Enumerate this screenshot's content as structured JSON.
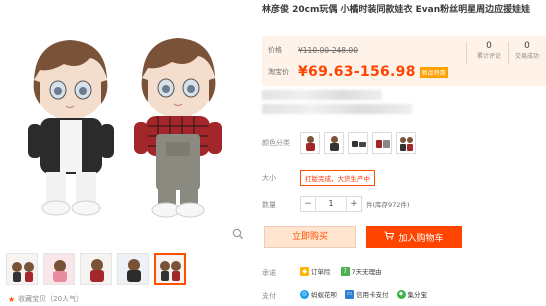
{
  "product": {
    "title": "林彦俊 20cm玩偶 小橘时装同款娃衣 Evan粉丝明星周边应援娃娃"
  },
  "price": {
    "list_label": "价格",
    "list_value": "¥110.00-248.00",
    "promo_label": "淘宝价",
    "promo_value": "¥69.63-156.98",
    "promo_badge": "新品特惠"
  },
  "stats": [
    {
      "count": "0",
      "label": "累计评论"
    },
    {
      "count": "0",
      "label": "交易成功"
    }
  ],
  "options": {
    "color_label": "颜色分类",
    "size_label": "大小",
    "size_value": "打版完成，大货生产中",
    "qty_label": "数量",
    "qty_minus": "−",
    "qty_value": "1",
    "qty_plus": "+",
    "stock_text": "件(库存972件)"
  },
  "actions": {
    "buy_now": "立即购买",
    "add_cart": "加入购物车",
    "cart_icon": "cart-icon"
  },
  "promise": {
    "label": "承诺",
    "items": [
      {
        "icon": "credit-icon",
        "text": "订单险"
      },
      {
        "icon": "seven-days-icon",
        "glyph": "7",
        "text": "7天无理由"
      }
    ]
  },
  "payment": {
    "label": "支付",
    "methods": [
      {
        "text": "蚂蚁花呗"
      },
      {
        "text": "信用卡支付"
      },
      {
        "text": "集分宝"
      }
    ]
  },
  "gallery": {
    "collect_text": "收藏宝贝（20人气）"
  },
  "colors": {
    "accent": "#ff5000",
    "price": "#ff4400",
    "price_bg": "#fff2e8"
  }
}
